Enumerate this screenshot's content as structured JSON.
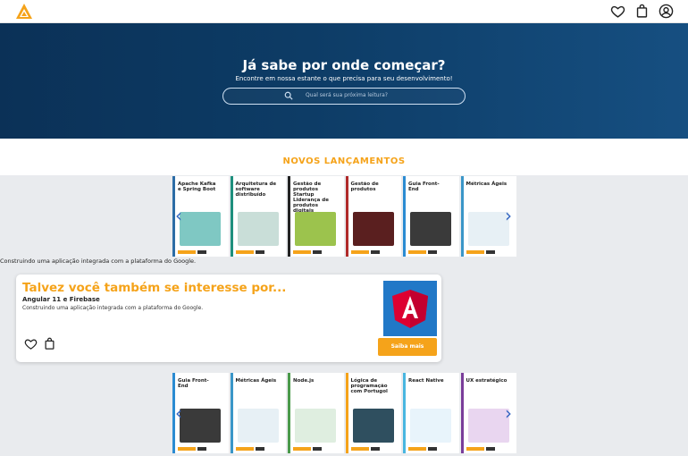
{
  "hero": {
    "title": "Já sabe por onde começar?",
    "subtitle": "Encontre em nossa estante o que precisa para seu desenvolvimento!",
    "search_placeholder": "Qual será sua próxima leitura?"
  },
  "section": {
    "title": "NOVOS LANÇAMENTOS"
  },
  "row1": [
    {
      "title": "Apache Kafka e Spring Boot",
      "stripe": "#2c6ca6",
      "art": "#7fc8c3"
    },
    {
      "title": "Arquitetura de software distribuído",
      "stripe": "#1e8f7d",
      "art": "#c9ded8"
    },
    {
      "title": "Gestão de produtos  Startup  Liderança de produtos digitais",
      "stripe": "#222222",
      "art": "#9cc34d"
    },
    {
      "title": "Gestão de produtos",
      "stripe": "#b02a2a",
      "art": "#5a1f1f"
    },
    {
      "title": "Guia Front-End",
      "stripe": "#2b8bd2",
      "art": "#3a3a3a"
    },
    {
      "title": "Métricas Ágeis",
      "stripe": "#3a96c8",
      "art": "#e7f0f5"
    }
  ],
  "promo": {
    "caption": "Construindo uma aplicação integrada com a plataforma do Google.",
    "title": "Talvez você também se interesse por...",
    "book": "Angular 11 e Firebase",
    "description": "Construindo uma aplicação integrada com a plataforma do Google.",
    "button": "Saiba mais"
  },
  "row2": [
    {
      "title": "Guia Front-End",
      "stripe": "#2b8bd2",
      "art": "#3a3a3a"
    },
    {
      "title": "Métricas Ágeis",
      "stripe": "#3a96c8",
      "art": "#e7f0f5"
    },
    {
      "title": "Node.js",
      "stripe": "#4a9a4a",
      "art": "#dfeee0"
    },
    {
      "title": "Lógica de programação com Portugol",
      "stripe": "#f5a31a",
      "art": "#2f4f5f"
    },
    {
      "title": "React Native",
      "stripe": "#49b6e0",
      "art": "#e8f4fb"
    },
    {
      "title": "UX estratégico",
      "stripe": "#7a3d9a",
      "art": "#e9d6f0"
    }
  ],
  "colors": {
    "accent": "#f5a31a",
    "hero_dark": "#0b3157",
    "angular_bg": "#2178c7"
  }
}
